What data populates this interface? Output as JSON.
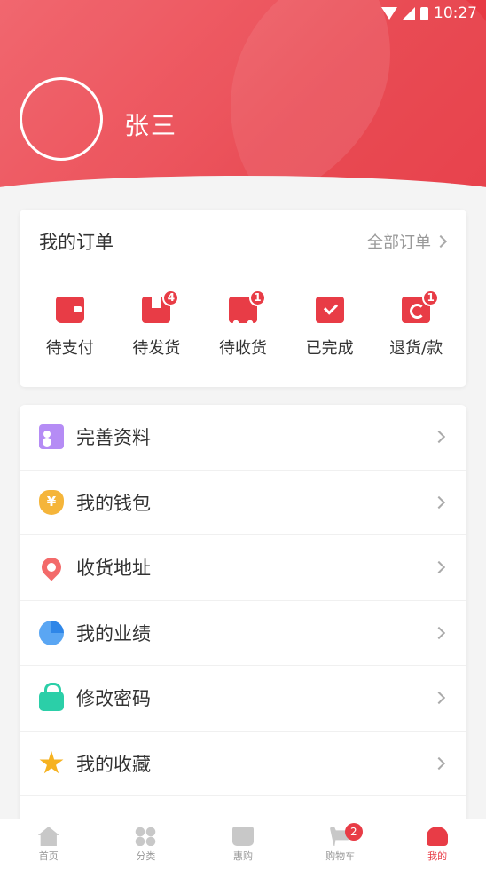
{
  "status_bar": {
    "time": "10:27"
  },
  "profile": {
    "name": "张三"
  },
  "orders": {
    "title": "我的订单",
    "all_label": "全部订单",
    "items": [
      {
        "label": "待支付",
        "icon": "wallet-icon",
        "badge": ""
      },
      {
        "label": "待发货",
        "icon": "package-icon",
        "badge": "4"
      },
      {
        "label": "待收货",
        "icon": "delivery-truck-icon",
        "badge": "1"
      },
      {
        "label": "已完成",
        "icon": "checkmark-icon",
        "badge": ""
      },
      {
        "label": "退货/款",
        "icon": "return-icon",
        "badge": "1"
      }
    ]
  },
  "menu": {
    "items": [
      {
        "label": "完善资料",
        "icon": "profile-card-icon"
      },
      {
        "label": "我的钱包",
        "icon": "money-bag-icon"
      },
      {
        "label": "收货地址",
        "icon": "location-pin-icon"
      },
      {
        "label": "我的业绩",
        "icon": "pie-chart-icon"
      },
      {
        "label": "修改密码",
        "icon": "lock-icon"
      },
      {
        "label": "我的收藏",
        "icon": "star-icon"
      }
    ]
  },
  "tabbar": {
    "items": [
      {
        "label": "首页",
        "icon": "home-icon"
      },
      {
        "label": "分类",
        "icon": "category-grid-icon"
      },
      {
        "label": "惠购",
        "icon": "shopping-bag-icon"
      },
      {
        "label": "购物车",
        "icon": "cart-icon",
        "badge": "2"
      },
      {
        "label": "我的",
        "icon": "user-icon"
      }
    ],
    "active_index": 4
  },
  "colors": {
    "primary": "#e83c46",
    "background": "#f4f4f4"
  }
}
